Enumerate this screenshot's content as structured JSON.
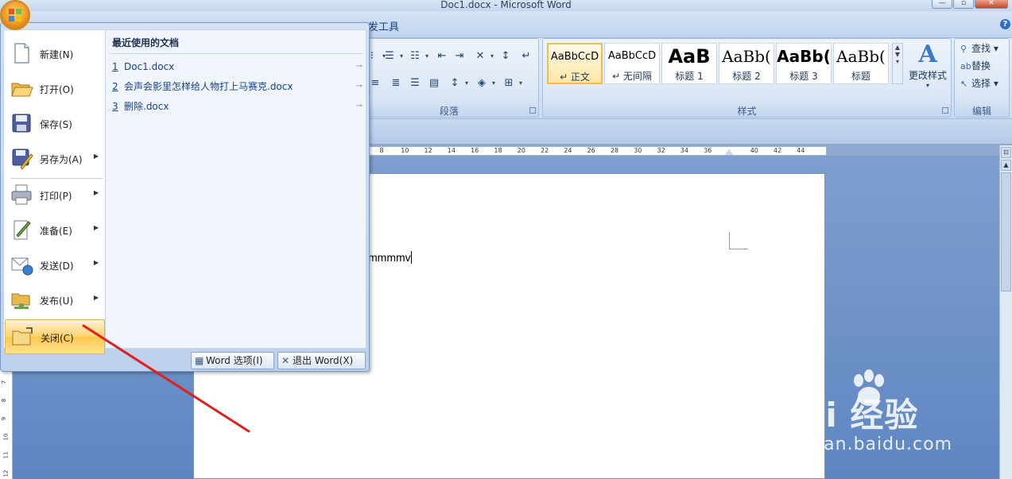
{
  "window": {
    "title": "Doc1.docx - Microsoft Word",
    "controls": [
      "minimize",
      "maximize",
      "close"
    ]
  },
  "tabs": {
    "visible_partial": "发工具"
  },
  "ribbon": {
    "groups": {
      "paragraph": "段落",
      "styles": "样式",
      "editing": "编辑"
    },
    "styles_gallery": [
      {
        "preview": "AaBbCcD",
        "name": "↵ 正文",
        "selected": true
      },
      {
        "preview": "AaBbCcD",
        "name": "↵ 无间隔",
        "selected": false
      },
      {
        "preview": "AaB",
        "name": "标题 1",
        "selected": false
      },
      {
        "preview": "AaBb(",
        "name": "标题 2",
        "selected": false
      },
      {
        "preview": "AaBb(",
        "name": "标题 3",
        "selected": false
      },
      {
        "preview": "AaBb(",
        "name": "标题",
        "selected": false
      }
    ],
    "change_styles": "更改样式",
    "edit_items": [
      "查找 ▾",
      "替换",
      "选择 ▾"
    ]
  },
  "ruler": {
    "labels": [
      "8",
      "10",
      "12",
      "14",
      "16",
      "18",
      "20",
      "22",
      "24",
      "26",
      "28",
      "30",
      "32",
      "34",
      "36",
      "",
      "40",
      "42",
      "44"
    ],
    "vertical_labels": [
      "7",
      "8",
      "9",
      "10",
      "11",
      "12"
    ]
  },
  "document": {
    "text": "mmmmv"
  },
  "office_menu": {
    "items": [
      {
        "label": "新建(N)",
        "icon": "new-document-icon",
        "submenu": false
      },
      {
        "label": "打开(O)",
        "icon": "open-folder-icon",
        "submenu": false
      },
      {
        "label": "保存(S)",
        "icon": "save-disk-icon",
        "submenu": false
      },
      {
        "label": "另存为(A)",
        "icon": "save-as-icon",
        "submenu": true
      },
      {
        "label": "打印(P)",
        "icon": "printer-icon",
        "submenu": true
      },
      {
        "label": "准备(E)",
        "icon": "prepare-icon",
        "submenu": true
      },
      {
        "label": "发送(D)",
        "icon": "send-icon",
        "submenu": true
      },
      {
        "label": "发布(U)",
        "icon": "publish-icon",
        "submenu": true
      },
      {
        "label": "关闭(C)",
        "icon": "close-folder-icon",
        "submenu": false,
        "highlighted": true
      }
    ],
    "recent_header": "最近使用的文档",
    "recent_docs": [
      {
        "num": "1",
        "name": "Doc1.docx"
      },
      {
        "num": "2",
        "name": "会声会影里怎样给人物打上马赛克.docx"
      },
      {
        "num": "3",
        "name": "删除.docx"
      }
    ],
    "word_options": "Word 选项(I)",
    "exit_word": "退出 Word(X)"
  },
  "watermark": {
    "brand": "Bai  经验",
    "url": "jingyan.baidu.com"
  },
  "colors": {
    "ribbon_bg": "#dbe7f6",
    "doc_bg": "#6f93c8",
    "highlight": "#ffd26f",
    "annotation": "#e02020"
  }
}
